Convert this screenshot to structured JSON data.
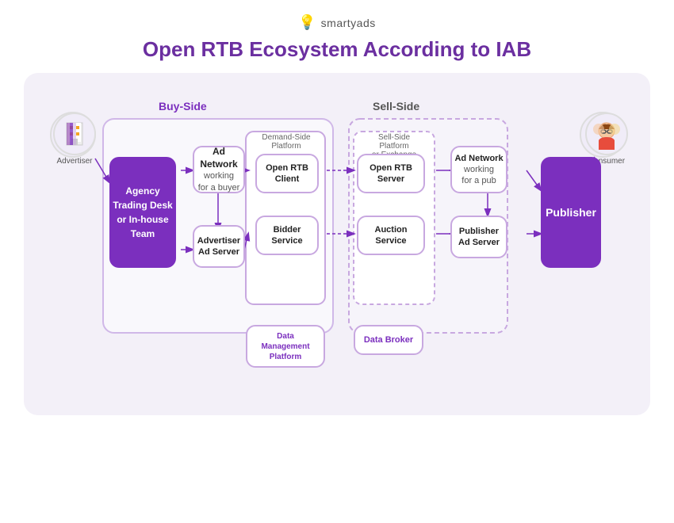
{
  "header": {
    "logo_icon": "💡",
    "logo_text": "smartyads",
    "title": "Open RTB Ecosystem According to IAB"
  },
  "sides": {
    "buy": "Buy-Side",
    "sell": "Sell-Side"
  },
  "nodes": {
    "advertiser_label": "Advertiser",
    "consumer_label": "Consumer",
    "agency": {
      "line1": "Agency",
      "line2": "Trading Desk",
      "line3": "or In-house",
      "line4": "Team"
    },
    "ad_network_buy": {
      "title": "Ad Network",
      "sub": "working\nfor a buyer"
    },
    "advertiser_ad_server": {
      "title": "Advertiser\nAd Server",
      "sub": ""
    },
    "dsp_label": "Demand-Side\nPlatform",
    "open_rtb_client": {
      "title": "Open RTB\nClient"
    },
    "bidder_service": {
      "title": "Bidder\nService"
    },
    "data_mgmt": {
      "title": "Data\nManagement\nPlatform"
    },
    "ssp_label": "Sell-Side\nPlatform\nor Exchange",
    "open_rtb_server": {
      "title": "Open RTB\nServer"
    },
    "auction_service": {
      "title": "Auction\nService"
    },
    "data_broker": {
      "title": "Data Broker"
    },
    "ad_network_sell": {
      "title": "Ad Network",
      "sub": "working\nfor a pub"
    },
    "publisher_ad_server": {
      "title": "Publisher\nAd Server"
    },
    "publisher": {
      "label": "Publisher"
    }
  },
  "colors": {
    "purple": "#7b2fbe",
    "light_purple": "#c8a8e0",
    "bg": "#f3f0f8",
    "white": "#ffffff",
    "text_dark": "#222222",
    "text_mid": "#555555"
  }
}
